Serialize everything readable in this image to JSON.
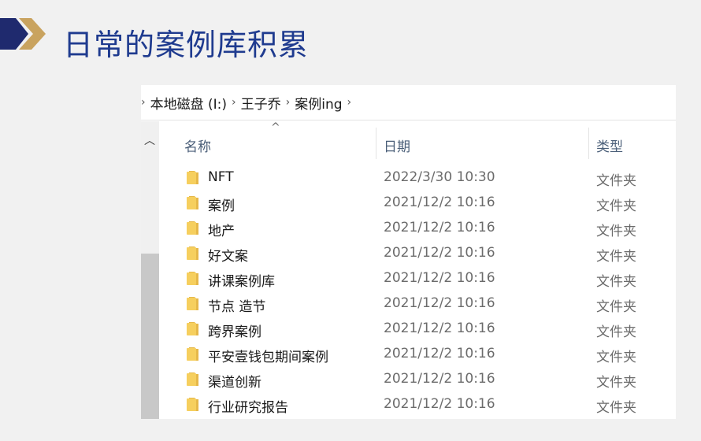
{
  "slide": {
    "title": "日常的案例库积累",
    "accent_blue": "#1f2a6e",
    "accent_gold": "#c9a35f"
  },
  "breadcrumb": {
    "items": [
      "本地磁盘 (I:)",
      "王子乔",
      "案例ing"
    ]
  },
  "columns": {
    "name": "名称",
    "date": "日期",
    "type": "类型"
  },
  "files": [
    {
      "name": "NFT",
      "date": "2022/3/30 10:30",
      "type": "文件夹",
      "icon": "folder-icon"
    },
    {
      "name": "案例",
      "date": "2021/12/2 10:16",
      "type": "文件夹",
      "icon": "folder-icon"
    },
    {
      "name": "地产",
      "date": "2021/12/2 10:16",
      "type": "文件夹",
      "icon": "folder-icon"
    },
    {
      "name": "好文案",
      "date": "2021/12/2 10:16",
      "type": "文件夹",
      "icon": "folder-icon"
    },
    {
      "name": "讲课案例库",
      "date": "2021/12/2 10:16",
      "type": "文件夹",
      "icon": "folder-icon"
    },
    {
      "name": "节点 造节",
      "date": "2021/12/2 10:16",
      "type": "文件夹",
      "icon": "folder-icon"
    },
    {
      "name": "跨界案例",
      "date": "2021/12/2 10:16",
      "type": "文件夹",
      "icon": "folder-icon"
    },
    {
      "name": "平安壹钱包期间案例",
      "date": "2021/12/2 10:16",
      "type": "文件夹",
      "icon": "folder-icon"
    },
    {
      "name": "渠道创新",
      "date": "2021/12/2 10:16",
      "type": "文件夹",
      "icon": "folder-icon"
    },
    {
      "name": "行业研究报告",
      "date": "2021/12/2 10:16",
      "type": "文件夹",
      "icon": "folder-icon"
    }
  ]
}
